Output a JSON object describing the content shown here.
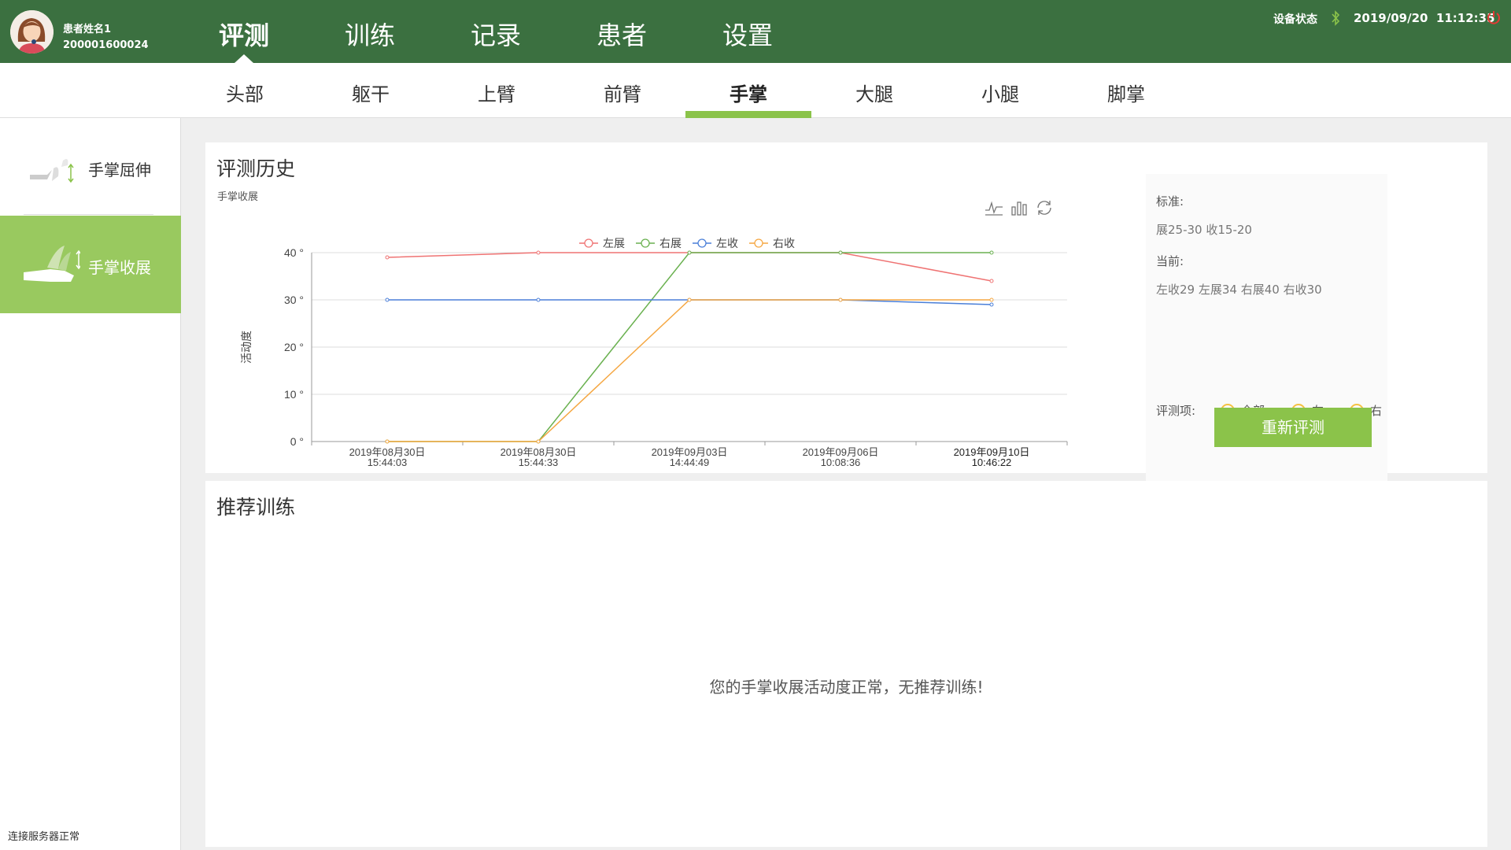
{
  "header": {
    "patient_name": "患者姓名1",
    "patient_id": "200001600024",
    "tabs": [
      {
        "label": "评测",
        "active": true
      },
      {
        "label": "训练",
        "active": false
      },
      {
        "label": "记录",
        "active": false
      },
      {
        "label": "患者",
        "active": false
      },
      {
        "label": "设置",
        "active": false
      }
    ],
    "device_status_label": "设备状态",
    "date": "2019/09/20",
    "time": "11:12:35"
  },
  "subtabs": [
    {
      "label": "头部",
      "active": false
    },
    {
      "label": "躯干",
      "active": false
    },
    {
      "label": "上臂",
      "active": false
    },
    {
      "label": "前臂",
      "active": false
    },
    {
      "label": "手掌",
      "active": true
    },
    {
      "label": "大腿",
      "active": false
    },
    {
      "label": "小腿",
      "active": false
    },
    {
      "label": "脚掌",
      "active": false
    }
  ],
  "sidebar": {
    "items": [
      {
        "label": "手掌屈伸",
        "active": false
      },
      {
        "label": "手掌收展",
        "active": true
      }
    ],
    "server_status": "连接服务器正常"
  },
  "history": {
    "title": "评测历史",
    "chart_subtitle": "手掌收展"
  },
  "info": {
    "standard_label": "标准:",
    "standard_value": "展25-30 收15-20",
    "current_label": "当前:",
    "current_value": "左收29 左展34 右展40 右收30",
    "items_label": "评测项:",
    "options": [
      {
        "label": "全部",
        "checked": true
      },
      {
        "label": "左",
        "checked": false
      },
      {
        "label": "右",
        "checked": false
      }
    ],
    "reeval_button": "重新评测"
  },
  "recommend": {
    "title": "推荐训练",
    "message": "您的手掌收展活动度正常，无推荐训练!"
  },
  "colors": {
    "header_green": "#3b7040",
    "accent_green": "#8bc34a",
    "series_left_ext": "#ef7373",
    "series_right_ext": "#6ab150",
    "series_left_add": "#4a7fd8",
    "series_right_add": "#f5a742"
  },
  "chart_data": {
    "type": "line",
    "ylabel": "活动度",
    "ylim": [
      0,
      40
    ],
    "yticks": [
      "0 °",
      "10 °",
      "20 °",
      "30 °",
      "40 °"
    ],
    "ytick_values": [
      0,
      10,
      20,
      30,
      40
    ],
    "categories": [
      [
        "2019年08月30日",
        "15:44:03"
      ],
      [
        "2019年08月30日",
        "15:44:33"
      ],
      [
        "2019年09月03日",
        "14:44:49"
      ],
      [
        "2019年09月06日",
        "10:08:36"
      ],
      [
        "2019年09月10日",
        "10:46:22"
      ]
    ],
    "series": [
      {
        "name": "左展",
        "color": "#ef7373",
        "values": [
          39,
          40,
          40,
          40,
          34
        ]
      },
      {
        "name": "右展",
        "color": "#6ab150",
        "values": [
          0,
          0,
          40,
          40,
          40
        ]
      },
      {
        "name": "左收",
        "color": "#4a7fd8",
        "values": [
          30,
          30,
          30,
          30,
          29
        ]
      },
      {
        "name": "右收",
        "color": "#f5a742",
        "values": [
          0,
          0,
          30,
          30,
          30
        ]
      }
    ],
    "grid": true,
    "legend": "top-center"
  }
}
